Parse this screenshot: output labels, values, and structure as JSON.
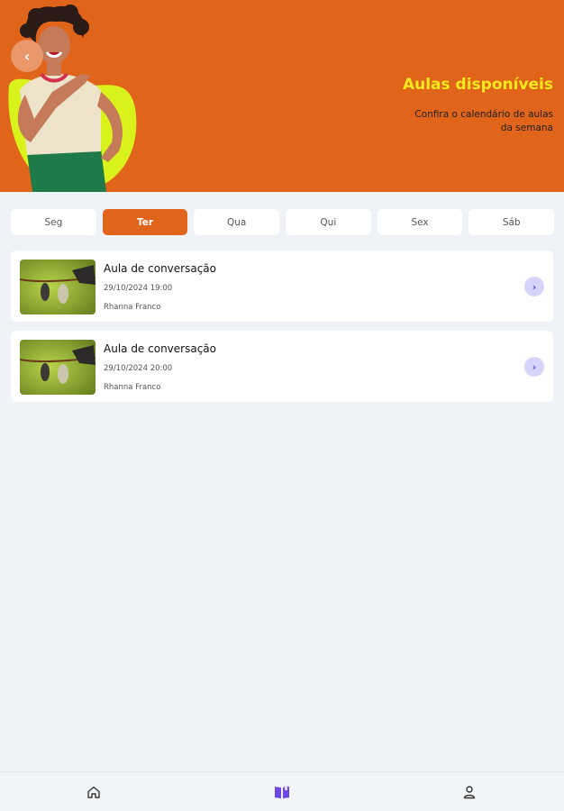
{
  "header": {
    "title": "Aulas disponíveis",
    "subtitle": "Confira o calendário de aulas da semana",
    "accent_color": "#e0651a",
    "title_color": "#f7e91c",
    "back_icon": "chevron-left-icon"
  },
  "days": [
    {
      "label": "Seg",
      "active": false
    },
    {
      "label": "Ter",
      "active": true
    },
    {
      "label": "Qua",
      "active": false
    },
    {
      "label": "Qui",
      "active": false
    },
    {
      "label": "Sex",
      "active": false
    },
    {
      "label": "Sáb",
      "active": false
    }
  ],
  "classes": [
    {
      "title": "Aula de conversação",
      "datetime": "29/10/2024 19:00",
      "teacher": "Rhanna Franco",
      "thumbnail": "butterfly-chrysalis-image"
    },
    {
      "title": "Aula de conversação",
      "datetime": "29/10/2024 20:00",
      "teacher": "Rhanna Franco",
      "thumbnail": "butterfly-chrysalis-image"
    }
  ],
  "bottom_nav": [
    {
      "icon": "home-icon",
      "active": false
    },
    {
      "icon": "book-icon",
      "active": true,
      "color": "#6b46e5"
    },
    {
      "icon": "user-icon",
      "active": false
    }
  ]
}
